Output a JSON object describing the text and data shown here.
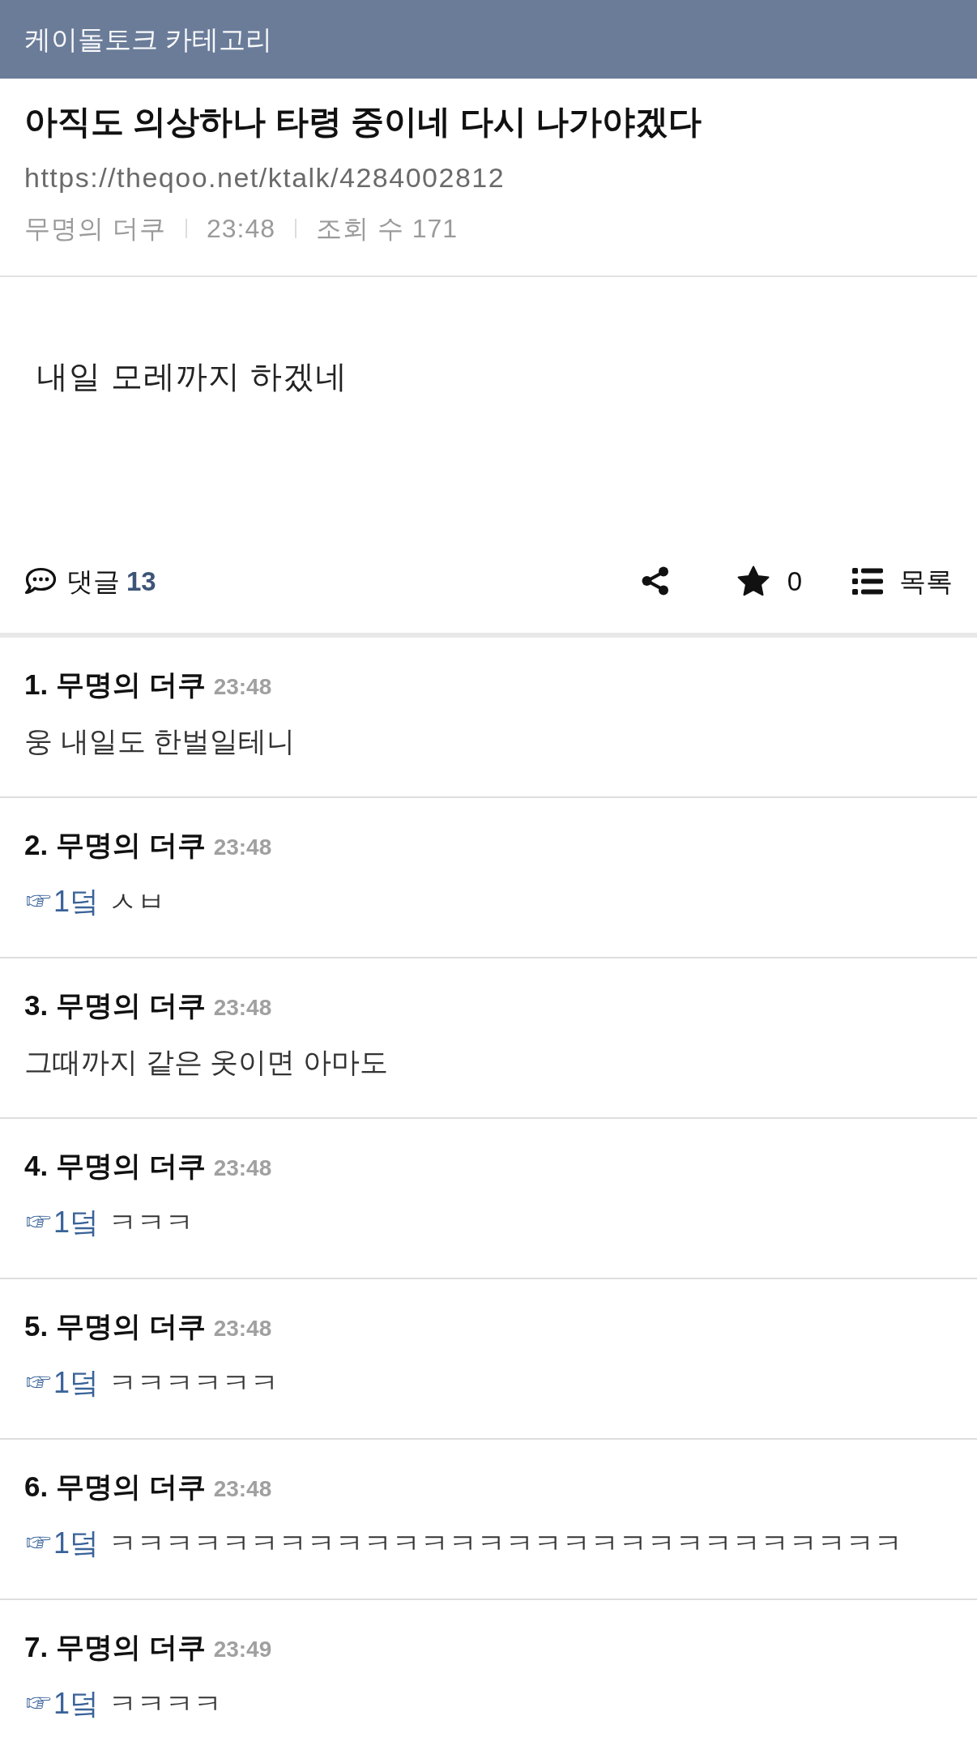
{
  "header": {
    "title": "케이돌토크 카테고리"
  },
  "post": {
    "title": "아직도 의상하나 타령 중이네 다시 나가야겠다",
    "url": "https://theqoo.net/ktalk/4284002812",
    "meta": [
      "무명의 더쿠",
      "23:48",
      "조회 수 171"
    ],
    "body": "내일 모레까지 하겠네"
  },
  "actions": {
    "comments_label": "댓글",
    "comment_count": "13",
    "favorite_count": "0",
    "list_label": "목록"
  },
  "comments": [
    {
      "author": "1. 무명의 더쿠",
      "time": "23:48",
      "text": "웅 내일도 한벌일테니"
    },
    {
      "author": "2. 무명의 더쿠",
      "time": "23:48",
      "reply_to": "☞1덬",
      "text": "ㅅㅂ"
    },
    {
      "author": "3. 무명의 더쿠",
      "time": "23:48",
      "text": "그때까지 같은 옷이면 아마도"
    },
    {
      "author": "4. 무명의 더쿠",
      "time": "23:48",
      "reply_to": "☞1덬",
      "text": "ㅋㅋㅋ"
    },
    {
      "author": "5. 무명의 더쿠",
      "time": "23:48",
      "reply_to": "☞1덬",
      "text": "ㅋㅋㅋㅋㅋㅋ"
    },
    {
      "author": "6. 무명의 더쿠",
      "time": "23:48",
      "reply_to": "☞1덬",
      "text": "ㅋㅋㅋㅋㅋㅋㅋㅋㅋㅋㅋㅋㅋㅋㅋㅋㅋㅋㅋㅋㅋㅋㅋㅋㅋㅋㅋㅋ"
    },
    {
      "author": "7. 무명의 더쿠",
      "time": "23:49",
      "reply_to": "☞1덬",
      "text": "ㅋㅋㅋㅋ"
    }
  ]
}
